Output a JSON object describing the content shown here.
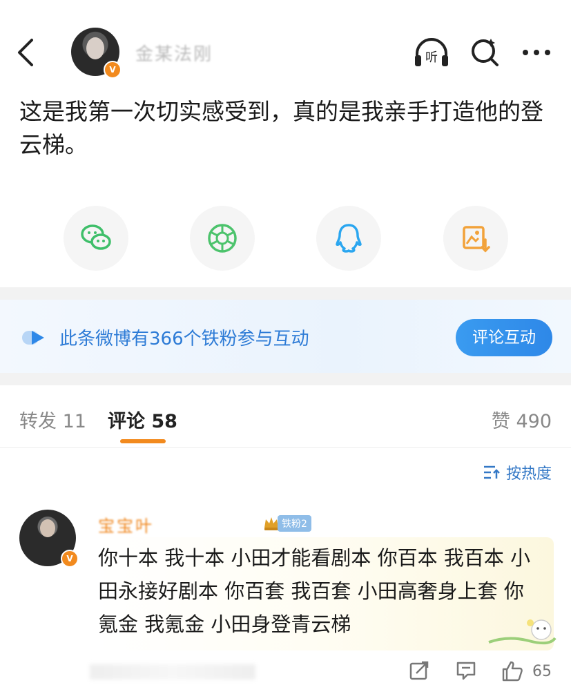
{
  "header": {
    "author_name": "金某法刚",
    "verified_badge": "V",
    "listen_label": "听"
  },
  "post": {
    "text": "这是我第一次切实感受到，真的是我亲手打造他的登云梯。"
  },
  "share_row": [
    "wechat-icon",
    "moments-icon",
    "qq-icon",
    "save-image-icon"
  ],
  "fan_bar": {
    "text": "此条微博有366个铁粉参与互动",
    "button": "评论互动"
  },
  "tabs": {
    "repost": "转发 11",
    "comments": "评论 58",
    "likes": "赞 490"
  },
  "sort": {
    "label": "按热度"
  },
  "comment": {
    "author": "宝宝叶",
    "fan_badge": "铁粉2",
    "verified_badge": "V",
    "text": "你十本 我十本 小田才能看剧本 你百本 我百本 小田永接好剧本 你百套 我百套 小田高奢身上套 你氪金 我氪金 小田身登青云梯",
    "like_count": "65"
  },
  "colors": {
    "accent": "#f28a1e",
    "link_blue": "#2d7bd6",
    "button_blue": "#2e88e8",
    "wechat_green": "#3fbf6a",
    "qq_blue": "#2aa6f0",
    "save_orange": "#f2a23a"
  }
}
